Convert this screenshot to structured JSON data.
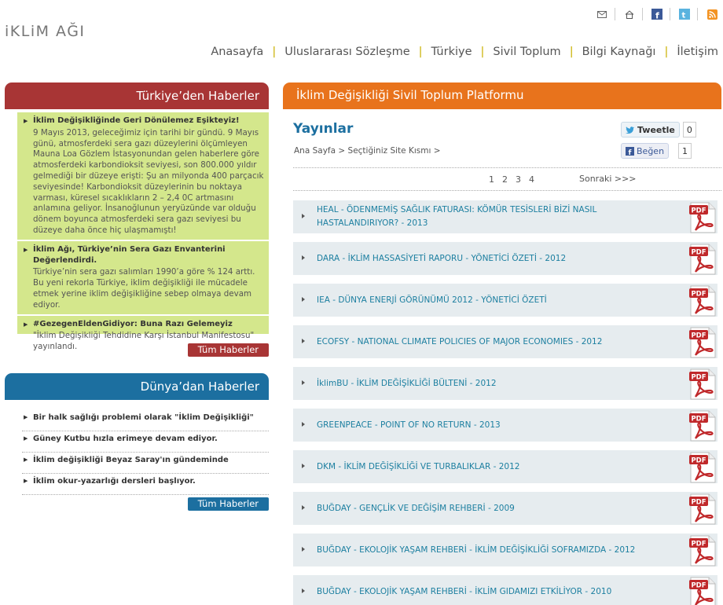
{
  "logo": "iKLiM AĞI",
  "top_icons": [
    "email-icon",
    "home-icon",
    "facebook-icon",
    "twitter-icon",
    "rss-icon"
  ],
  "nav": [
    "Anasayfa",
    "Uluslararası Sözleşme",
    "Türkiye",
    "Sivil Toplum",
    "Bilgi Kaynağı",
    "İletişim"
  ],
  "turkiye": {
    "title": "Türkiye’den Haberler",
    "items": [
      {
        "title": "İklim Değişikliğinde Geri Dönülemez Eşikteyiz!",
        "text": "9 Mayıs 2013, geleceğimiz için tarihi bir gündü. 9 Mayıs günü, atmosferdeki sera gazı düzeylerini ölçümleyen Mauna Loa Gözlem İstasyonundan gelen haberlere göre atmosferdeki karbondioksit seviyesi, son 800.000 yıldır gelmediği bir düzeye erişti: Şu an milyonda 400 parçacık seviyesinde! Karbondioksit düzeylerinin bu noktaya varması, küresel sıcaklıkların 2 – 2,4 0C artmasını anlamına geliyor. İnsanoğlunun yeryüzünde var olduğu dönem boyunca atmosferdeki sera gazı seviyesi bu düzeye daha önce hiç ulaşmamıştı!"
      },
      {
        "title": "İklim Ağı, Türkiye’nin Sera Gazı Envanterini Değerlendirdi.",
        "text": "Türkiye’nin sera gazı salımları 1990’a göre % 124 arttı. Bu yeni rekorla Türkiye, iklim değişikliği ile mücadele etmek yerine iklim değişikliğine sebep olmaya devam ediyor."
      },
      {
        "title": "#GezegenEldenGidiyor: Buna Razı Gelemeyiz",
        "text": "\"İklim Değişikliği Tehdidine Karşı İstanbul Manifestosu\" yayınlandı."
      }
    ],
    "button": "Tüm Haberler"
  },
  "dunya": {
    "title": "Dünya’dan Haberler",
    "items": [
      "Bir halk sağlığı problemi olarak \"İklim Değişikliği\"",
      "Güney Kutbu hızla erimeye devam ediyor.",
      "İklim değişikliği Beyaz Saray'ın gündeminde",
      "İklim okur-yazarlığı dersleri başlıyor."
    ],
    "button": "Tüm Haberler"
  },
  "main": {
    "header": "İklim Değişikliği Sivil Toplum Platformu",
    "title": "Yayınlar",
    "breadcrumb": "Ana Sayfa > Seçtiğiniz Site Kısmı >",
    "tweet_label": "Tweetle",
    "tweet_count": "0",
    "like_label": "Beğen",
    "like_count": "1",
    "pages": [
      "1",
      "2",
      "3",
      "4"
    ],
    "next": "Sonraki >>>",
    "publications": [
      "HEAL - ÖDENMEMİŞ SAĞLIK FATURASI: KÖMÜR TESİSLERİ BİZİ NASIL HASTALANDIRIYOR? - 2013",
      "DARA - İKLİM HASSASİYETİ RAPORU - YÖNETİCİ ÖZETİ - 2012",
      "IEA - DÜNYA ENERJİ GÖRÜNÜMÜ 2012 - YÖNETİCİ ÖZETİ",
      "ECOFSY - NATIONAL CLIMATE POLICIES OF MAJOR ECONOMIES - 2012",
      "İklimBU - İKLİM DEĞİŞİKLİĞİ BÜLTENİ - 2012",
      "GREENPEACE - POINT OF NO RETURN - 2013",
      "DKM - İKLİM DEĞİŞİKLİĞİ VE TURBALIKLAR - 2012",
      "BUĞDAY - GENÇLİK VE DEĞİŞİM REHBERİ - 2009",
      "BUĞDAY - EKOLOJİK YAŞAM REHBERİ - İKLİM DEĞİŞİKLİĞİ SOFRAMIZDA - 2012",
      "BUĞDAY - EKOLOJİK YAŞAM REHBERİ - İKLİM GIDAMIZI ETKİLİYOR - 2010"
    ],
    "pdf_label": "PDF"
  },
  "colors": {
    "red": "#a83535",
    "blue": "#1c6fa0",
    "orange": "#e8731c",
    "green": "#d4e78c",
    "link": "#1c7fa0"
  }
}
